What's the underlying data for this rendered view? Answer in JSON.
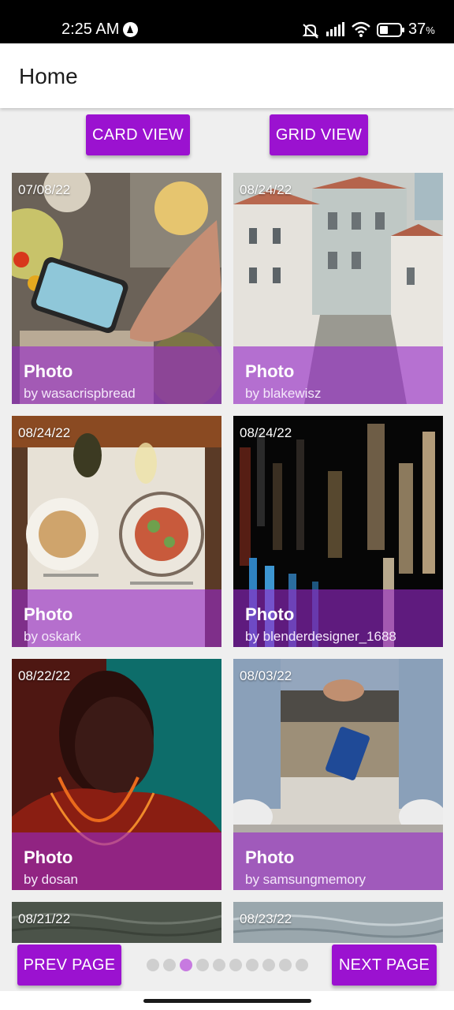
{
  "status_bar": {
    "time": "2:25 AM",
    "battery": "37",
    "battery_unit": "%",
    "icons": [
      "accessibility-icon",
      "mute-icon",
      "signal-icon",
      "wifi-icon",
      "battery-icon"
    ]
  },
  "app_bar": {
    "title": "Home"
  },
  "view_buttons": {
    "card": "CARD VIEW",
    "grid": "GRID VIEW"
  },
  "cards": [
    {
      "date": "07/08/22",
      "title": "Photo",
      "author": "by wasacrispbread"
    },
    {
      "date": "08/24/22",
      "title": "Photo",
      "author": "by blakewisz"
    },
    {
      "date": "08/24/22",
      "title": "Photo",
      "author": "by oskark"
    },
    {
      "date": "08/24/22",
      "title": "Photo",
      "author": "by blenderdesigner_1688"
    },
    {
      "date": "08/22/22",
      "title": "Photo",
      "author": "by dosan"
    },
    {
      "date": "08/03/22",
      "title": "Photo",
      "author": "by samsungmemory"
    },
    {
      "date": "08/21/22"
    },
    {
      "date": "08/23/22"
    }
  ],
  "pagination": {
    "prev": "PREV PAGE",
    "next": "NEXT PAGE",
    "page_count": 10,
    "current_page": 3
  },
  "colors": {
    "accent": "#9b12d0",
    "overlay": "#9628c8"
  }
}
